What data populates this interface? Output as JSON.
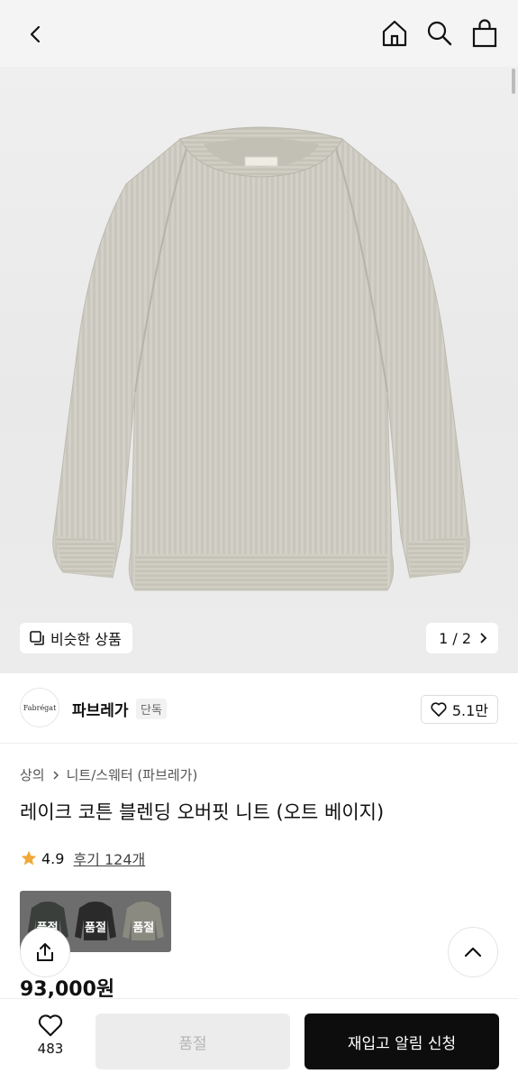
{
  "header": {
    "icons": [
      "chevron-left-icon",
      "home-icon",
      "search-icon",
      "shopping-bag-icon"
    ]
  },
  "gallery": {
    "similar_label": "비슷한 상품",
    "pager_label": "1 / 2"
  },
  "brand": {
    "logo_text": "Fabrégat",
    "name": "파브레가",
    "tag": "단독",
    "likes": "5.1만"
  },
  "breadcrumb": {
    "items": [
      "상의",
      "니트/스웨터 (파브레가)"
    ]
  },
  "product": {
    "title": "레이크 코튼 블렌딩 오버핏 니트 (오트 베이지)",
    "rating": "4.9",
    "review_label": "후기 124개",
    "price": "93,000원"
  },
  "swatches": [
    {
      "sold_label": "품절",
      "color": "#3a3f3c"
    },
    {
      "sold_label": "품절",
      "color": "#2a2a2a"
    },
    {
      "sold_label": "품절",
      "color": "#8a8a80"
    }
  ],
  "bottom": {
    "wish_count": "483",
    "soldout_label": "품절",
    "restock_label": "재입고 알림 신청"
  },
  "colors": {
    "accent_star": "#f2a93b",
    "primary_button": "#0d0d0d",
    "disabled_button": "#ececec"
  }
}
